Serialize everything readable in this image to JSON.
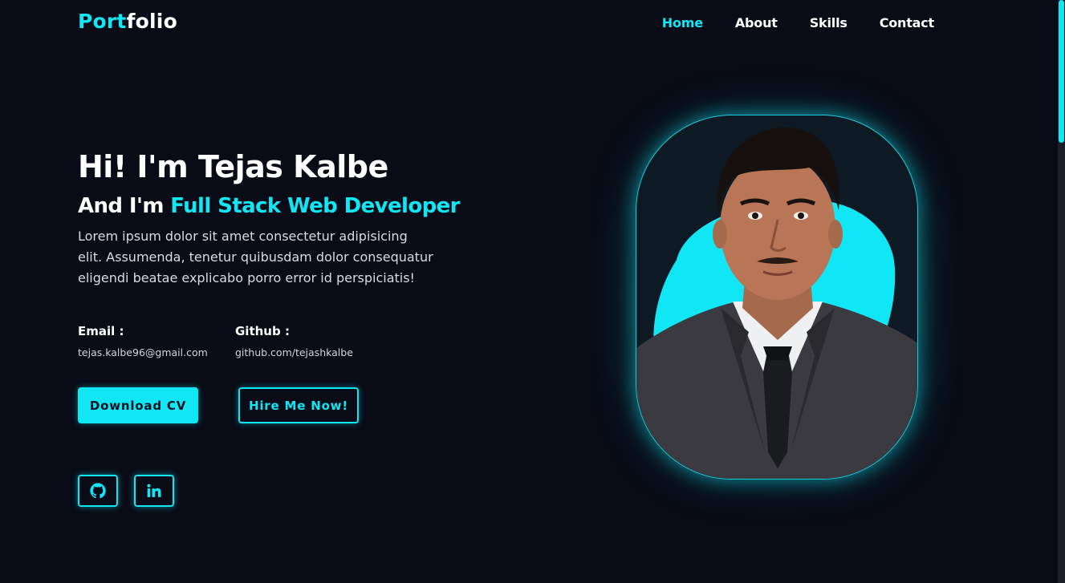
{
  "header": {
    "logo_accent": "Port",
    "logo_rest": "folio",
    "nav": [
      {
        "label": "Home",
        "active": true
      },
      {
        "label": "About",
        "active": false
      },
      {
        "label": "Skills",
        "active": false
      },
      {
        "label": "Contact",
        "active": false
      }
    ]
  },
  "hero": {
    "greeting": "Hi! I'm Tejas Kalbe",
    "subtitle_prefix": "And I'm ",
    "role": "Full Stack Web Developer",
    "description": "Lorem ipsum dolor sit amet consectetur adipisicing elit. Assumenda, tenetur quibusdam dolor consequatur eligendi beatae explicabo porro error id perspiciatis!",
    "email_label": "Email :",
    "email_value": "tejas.kalbe96@gmail.com",
    "github_label": "Github :",
    "github_value": "github.com/tejashkalbe",
    "download_label": "Download CV",
    "hire_label": "Hire Me Now!"
  },
  "social": [
    {
      "icon": "github-icon"
    },
    {
      "icon": "linkedin-icon"
    }
  ],
  "colors": {
    "accent": "#11e6f5",
    "background": "#090b16",
    "text": "#ffffff"
  }
}
